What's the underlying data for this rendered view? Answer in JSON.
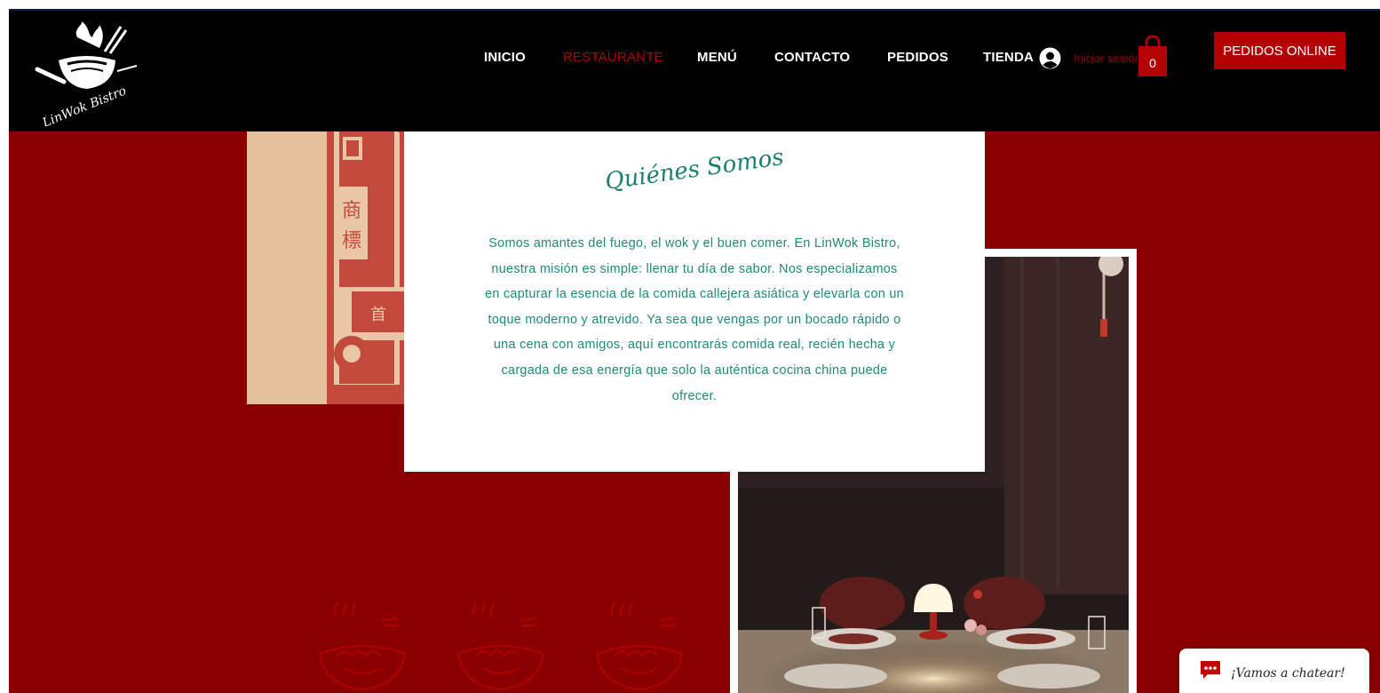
{
  "brand": {
    "name": "LinWok Bistro",
    "logo_icon": "wok-bowl-chopsticks-icon"
  },
  "nav": {
    "items": [
      {
        "label": "INICIO",
        "active": false
      },
      {
        "label": "RESTAURANTE",
        "active": true
      },
      {
        "label": "MENÚ",
        "active": false
      },
      {
        "label": "CONTACTO",
        "active": false
      },
      {
        "label": "PEDIDOS",
        "active": false
      },
      {
        "label": "TIENDA",
        "active": false
      }
    ],
    "login_label": "Iniciar sesión",
    "cart_count": "0",
    "order_button": "PEDIDOS ONLINE"
  },
  "about": {
    "title": "Quiénes Somos",
    "body": "Somos amantes del fuego, el wok y el buen comer. En LinWok Bistro, nuestra misión es simple: llenar tu día de sabor. Nos especializamos en capturar la esencia de la comida callejera asiática y elevarla con un toque moderno y atrevido. Ya sea que vengas por un bocado rápido o una cena con amigos, aquí encontrarás comida real, recién hecha y cargada de esa energía que solo la auténtica cocina china puede ofrecer."
  },
  "stamp": {
    "chars": [
      "商",
      "標",
      "首"
    ]
  },
  "chat": {
    "label": "¡Vamos a chatear!",
    "icon": "chat-bubble-icon"
  },
  "colors": {
    "background": "#8a0000",
    "header": "#000000",
    "accent_red": "#b30000",
    "teal_text": "#1f8a75"
  }
}
